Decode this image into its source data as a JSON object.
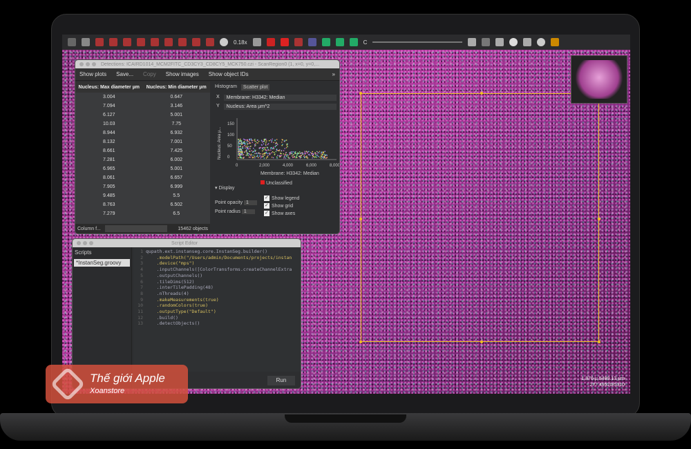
{
  "toolbar": {
    "zoom": "0.18x",
    "channel_label": "C"
  },
  "detections": {
    "title": "Detections: ICAIRD1014_MCM2FITC_CD3CY3_CD8CY5_MCK750.czi - ScanRegion0 (1, x=0, y=0,...",
    "buttons": [
      "Show plots",
      "Save...",
      "Copy",
      "Show images",
      "Show object IDs"
    ],
    "columns": [
      "Nucleus: Max diameter µm",
      "Nucleus: Min diameter µm"
    ],
    "rows": [
      [
        "3.004",
        "0.647"
      ],
      [
        "7.094",
        "3.146"
      ],
      [
        "6.127",
        "5.001"
      ],
      [
        "10.03",
        "7.75"
      ],
      [
        "8.944",
        "6.932"
      ],
      [
        "8.132",
        "7.001"
      ],
      [
        "8.661",
        "7.425"
      ],
      [
        "7.281",
        "6.002"
      ],
      [
        "6.965",
        "5.001"
      ],
      [
        "8.061",
        "6.657"
      ],
      [
        "7.905",
        "6.999"
      ],
      [
        "9.485",
        "5.5"
      ],
      [
        "8.763",
        "6.502"
      ],
      [
        "7.279",
        "6.5"
      ]
    ],
    "column_filter_label": "Column f...",
    "object_count": "15462 objects",
    "plot": {
      "tabs": [
        "Histogram",
        "Scatter plot"
      ],
      "active_tab": "Scatter plot",
      "x_label": "X",
      "x_value": "Membrane: H3342: Median",
      "y_label": "Y",
      "y_value": "Nucleus: Area µm^2",
      "y_axis_title": "Nucleus: Area µ...",
      "x_axis_title": "Membrane: H3342: Median",
      "y_ticks": [
        "150",
        "100",
        "50",
        "0"
      ],
      "x_ticks": [
        "0",
        "2,000",
        "4,000",
        "6,000",
        "8,000"
      ],
      "legend": "Unclassified",
      "legend_color": "#e02020"
    },
    "display": {
      "header": "Display",
      "point_opacity_label": "Point opacity",
      "point_opacity": "1",
      "point_radius_label": "Point radius",
      "point_radius": "1",
      "show_legend": "Show legend",
      "show_grid": "Show grid",
      "show_axes": "Show axes"
    }
  },
  "script_editor": {
    "title": "Script Editor",
    "scripts_header": "Scripts",
    "script_file": "*InstanSeg.groovy",
    "run": "Run",
    "lines": [
      "qupath.ext.instanseg.core.InstanSeg.builder()",
      "    .modelPath(\"/Users/admin/Documents/projects/instan",
      "    .device(\"mps\")",
      "    .inputChannels([ColorTransforms.createChannelExtra",
      "    .outputChannels()",
      "    .tileDims(512)",
      "    .interTilePadding(48)",
      "    .nThreads(4)",
      "    .makeMeasurements(true)",
      "    .randomColors(true)",
      "    .outputType(\"Default\")",
      "    .build()",
      "    .detectObjects()"
    ]
  },
  "viewer": {
    "coords_line1": "1,876 µ 5489.13 µm",
    "coords_line2": "277 49520/5310"
  },
  "watermark": {
    "title": "Thế giới Apple",
    "subtitle": "Xoanstore"
  }
}
